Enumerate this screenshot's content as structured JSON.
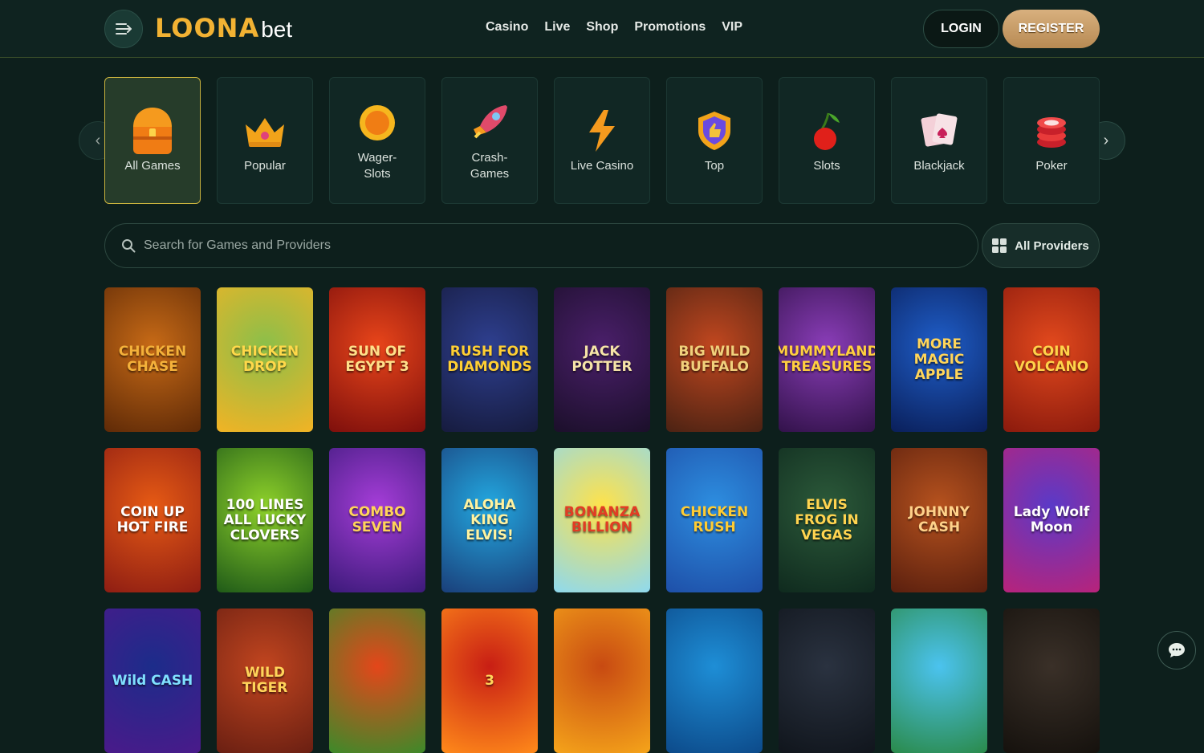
{
  "header": {
    "logo_brand": "LOONA",
    "logo_suffix": "bet",
    "nav": [
      "Casino",
      "Live",
      "Shop",
      "Promotions",
      "VIP"
    ],
    "login_label": "LOGIN",
    "register_label": "REGISTER"
  },
  "categories": [
    {
      "label": "All Games",
      "icon": "chest-icon",
      "active": true
    },
    {
      "label": "Popular",
      "icon": "crown-icon"
    },
    {
      "label": "Wager-\nSlots",
      "icon": "coin-icon"
    },
    {
      "label": "Crash-\nGames",
      "icon": "rocket-icon"
    },
    {
      "label": "Live Casino",
      "icon": "lightning-icon"
    },
    {
      "label": "Top",
      "icon": "thumbs-up-shield-icon"
    },
    {
      "label": "Slots",
      "icon": "cherry-icon"
    },
    {
      "label": "Blackjack",
      "icon": "playing-cards-icon"
    },
    {
      "label": "Poker",
      "icon": "poker-chips-icon"
    }
  ],
  "search": {
    "placeholder": "Search for Games and Providers"
  },
  "providers_label": "All Providers",
  "games": [
    {
      "title": "CHICKEN CHASE",
      "c1": "#c76a16",
      "c2": "#5f2a07",
      "tc": "#f4b13a"
    },
    {
      "title": "CHICKEN DROP",
      "c1": "#8bbf4a",
      "c2": "#f2b324",
      "tc": "#ffd84a"
    },
    {
      "title": "SUN OF EGYPT 3",
      "c1": "#e8451a",
      "c2": "#7e0f0c",
      "tc": "#ffe08a"
    },
    {
      "title": "RUSH FOR DIAMONDS",
      "c1": "#2e3f8f",
      "c2": "#161b3e",
      "tc": "#ffcf33"
    },
    {
      "title": "JACK POTTER",
      "c1": "#4a1f6a",
      "c2": "#1b0f2a",
      "tc": "#f6e4a8"
    },
    {
      "title": "BIG WILD BUFFALO",
      "c1": "#c1471f",
      "c2": "#4b2213",
      "tc": "#f1d17c"
    },
    {
      "title": "MUMMYLAND TREASURES",
      "c1": "#8a3db8",
      "c2": "#32124a",
      "tc": "#ffcf3f"
    },
    {
      "title": "MORE MAGIC APPLE",
      "c1": "#1f5ec9",
      "c2": "#0a1f5a",
      "tc": "#ffd55a"
    },
    {
      "title": "COIN VOLCANO",
      "c1": "#e2491d",
      "c2": "#8b1a0d",
      "tc": "#ffd34a"
    },
    {
      "title": "COIN UP HOT FIRE",
      "c1": "#e65a14",
      "c2": "#8e1d13",
      "tc": "#ffffff"
    },
    {
      "title": "100 LINES ALL LUCKY CLOVERS",
      "c1": "#8ed12a",
      "c2": "#1f5a18",
      "tc": "#ffffff"
    },
    {
      "title": "COMBO SEVEN",
      "c1": "#a53dd8",
      "c2": "#3c1a7a",
      "tc": "#ffd45a"
    },
    {
      "title": "ALOHA KING ELVIS!",
      "c1": "#23a8e0",
      "c2": "#1a3f7a",
      "tc": "#fff2a0"
    },
    {
      "title": "BONANZA BILLION",
      "c1": "#ffe24a",
      "c2": "#8ed9ef",
      "tc": "#e23c24"
    },
    {
      "title": "CHICKEN RUSH",
      "c1": "#2d8ee0",
      "c2": "#1e4fa8",
      "tc": "#ffcc33"
    },
    {
      "title": "ELVIS FROG IN VEGAS",
      "c1": "#2c5a3a",
      "c2": "#0f2a1e",
      "tc": "#ffd450"
    },
    {
      "title": "JOHNNY CASH",
      "c1": "#b6521e",
      "c2": "#5a1f0e",
      "tc": "#ffd28a"
    },
    {
      "title": "Lady Wolf Moon",
      "c1": "#5a3ac8",
      "c2": "#b8237a",
      "tc": "#ffffff"
    },
    {
      "title": "Wild CASH",
      "c1": "#1c2c8a",
      "c2": "#4a1a8a",
      "tc": "#7fe0ff"
    },
    {
      "title": "WILD TIGER",
      "c1": "#c1451f",
      "c2": "#6a1f12",
      "tc": "#ffd45a"
    },
    {
      "title": "",
      "c1": "#e4461a",
      "c2": "#3c8a2a",
      "tc": "#ffffff"
    },
    {
      "title": "3",
      "c1": "#c81e14",
      "c2": "#ff8a1a",
      "tc": "#ffd45a"
    },
    {
      "title": "",
      "c1": "#c84a12",
      "c2": "#f5a41a",
      "tc": "#ffffff"
    },
    {
      "title": "",
      "c1": "#1e8ed6",
      "c2": "#0c4a8a",
      "tc": "#ffffff"
    },
    {
      "title": "",
      "c1": "#2a3240",
      "c2": "#10151c",
      "tc": "#ffffff"
    },
    {
      "title": "",
      "c1": "#4bc3ef",
      "c2": "#2a8a4a",
      "tc": "#ffffff"
    },
    {
      "title": "",
      "c1": "#3a3028",
      "c2": "#15110d",
      "tc": "#ffffff"
    }
  ],
  "colors": {
    "accent": "#f2b233",
    "background": "#0d1f1c",
    "active_border": "#c9b23e"
  }
}
